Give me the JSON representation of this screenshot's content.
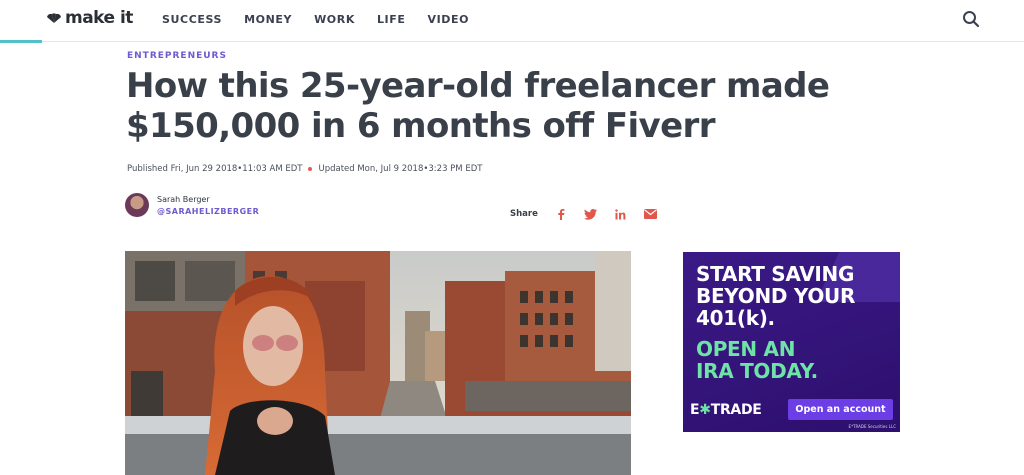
{
  "header": {
    "logo_text": "make it",
    "nav": [
      "SUCCESS",
      "MONEY",
      "WORK",
      "LIFE",
      "VIDEO"
    ]
  },
  "article": {
    "kicker": "ENTREPRENEURS",
    "headline": "How this 25-year-old freelancer made $150,000 in 6 months off Fiverr",
    "published": "Published Fri, Jun 29 2018•11:03 AM EDT",
    "updated": "Updated Mon, Jul 9 2018•3:23 PM EDT",
    "author_name": "Sarah Berger",
    "author_handle": "@SARAHELIZBERGER",
    "share_label": "Share",
    "share_icons": [
      "facebook-icon",
      "twitter-icon",
      "linkedin-icon",
      "email-icon"
    ]
  },
  "ad": {
    "line1": "START SAVING",
    "line2": "BEYOND YOUR",
    "line3": "401(k).",
    "cta_line1": "OPEN AN",
    "cta_line2": "IRA TODAY.",
    "brand_pre": "E",
    "brand_star": "✱",
    "brand_post": "TRADE",
    "button": "Open an account",
    "fine": "E*TRADE Securities LLC"
  },
  "colors": {
    "accent_purple": "#6d5bd0",
    "share_red": "#e2574c",
    "ad_bg": "#2d0f6e",
    "ad_green": "#6fe3a6"
  }
}
